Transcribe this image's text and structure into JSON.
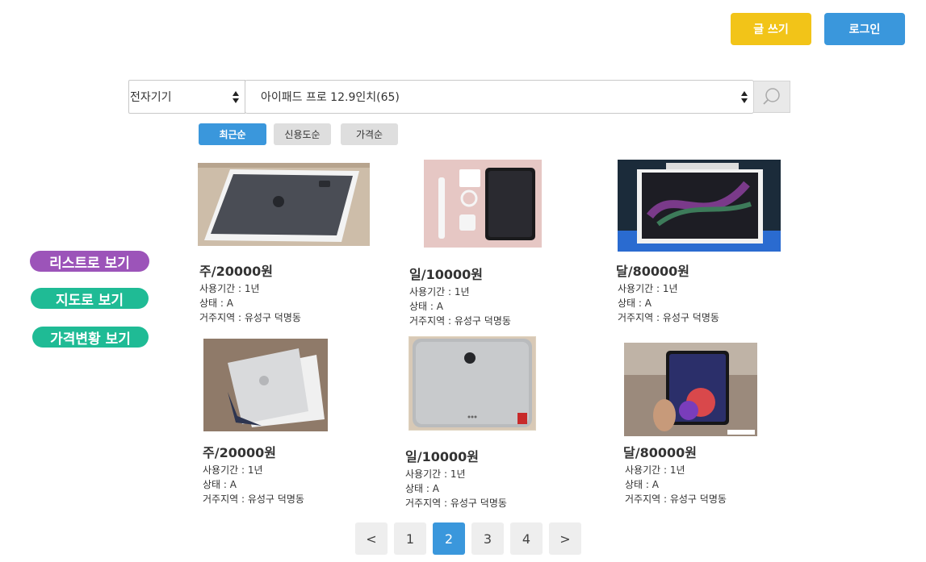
{
  "header": {
    "write_label": "글 쓰기",
    "login_label": "로그인"
  },
  "search": {
    "category_value": "전자기기",
    "item_value": "아이패드 프로 12.9인치(65)",
    "search_icon": "search-icon"
  },
  "sort_tabs": [
    {
      "label": "최근순",
      "active": true
    },
    {
      "label": "신용도순",
      "active": false
    },
    {
      "label": "가격순",
      "active": false
    }
  ],
  "side_menu": {
    "list_view": "리스트로 보기",
    "map_view": "지도로 보기",
    "price_trend": "가격변황 보기"
  },
  "labels": {
    "period": "사용기간 : ",
    "condition": "상태 : ",
    "region": "거주지역 : "
  },
  "products": [
    {
      "price": "주/20000원",
      "period": "1년",
      "condition": "A",
      "region": "유성구 덕명동",
      "image": "ipad-space-gray-back-in-box"
    },
    {
      "price": "일/10000원",
      "period": "1년",
      "condition": "A",
      "region": "유성구 덕명동",
      "image": "ipad-with-pencil-and-accessories"
    },
    {
      "price": "달/80000원",
      "period": "1년",
      "condition": "A",
      "region": "유성구 덕명동",
      "image": "ipad-pro-retail-box"
    },
    {
      "price": "주/20000원",
      "period": "1년",
      "condition": "A",
      "region": "유성구 덕명동",
      "image": "ipad-silver-back-on-table"
    },
    {
      "price": "일/10000원",
      "period": "1년",
      "condition": "A",
      "region": "유성구 덕명동",
      "image": "ipad-silver-back-closeup"
    },
    {
      "price": "달/80000원",
      "period": "1년",
      "condition": "A",
      "region": "유성구 덕명동",
      "image": "ipad-held-in-hand"
    }
  ],
  "pagination": {
    "prev": "<",
    "pages": [
      "1",
      "2",
      "3",
      "4"
    ],
    "current": "2",
    "next": ">"
  },
  "colors": {
    "primary": "#3a97dc",
    "write_button": "#f2c418",
    "list_view": "#9c54b9",
    "green": "#1fbb95"
  }
}
